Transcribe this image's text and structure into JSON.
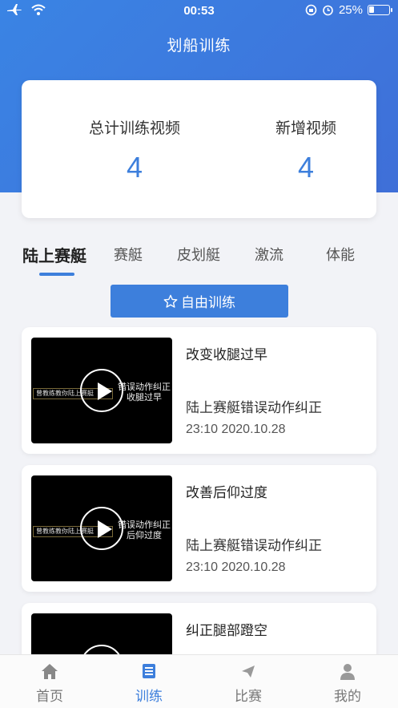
{
  "status_bar": {
    "time": "00:53",
    "battery": "25%",
    "battery_level": 0.25
  },
  "header": {
    "title": "划船训练"
  },
  "stats": {
    "total_label": "总计训练视频",
    "total_value": "4",
    "new_label": "新增视频",
    "new_value": "4"
  },
  "tabs": [
    {
      "label": "陆上赛艇",
      "active": true
    },
    {
      "label": "赛艇"
    },
    {
      "label": "皮划艇"
    },
    {
      "label": "激流"
    },
    {
      "label": "体能"
    }
  ],
  "free_training": {
    "label": "自由训练"
  },
  "videos": [
    {
      "title": "改变收腿过早",
      "category": "陆上赛艇错误动作纠正",
      "time": "23:10 2020.10.28",
      "thumb_banner": "曾教练教你陆上赛艇",
      "thumb_caption": "错误动作纠正 收腿过早"
    },
    {
      "title": "改善后仰过度",
      "category": "陆上赛艇错误动作纠正",
      "time": "23:10 2020.10.28",
      "thumb_banner": "曾教练教你陆上赛艇",
      "thumb_caption": "错误动作纠正 后仰过度"
    },
    {
      "title": "纠正腿部蹬空"
    }
  ],
  "bottom_nav": [
    {
      "label": "首页",
      "icon": "home-icon"
    },
    {
      "label": "训练",
      "icon": "training-icon",
      "active": true
    },
    {
      "label": "比赛",
      "icon": "paper-plane-icon"
    },
    {
      "label": "我的",
      "icon": "user-icon"
    }
  ],
  "colors": {
    "accent": "#3d7fdc",
    "header_start": "#3a84e4",
    "header_end": "#3f6fd8"
  }
}
